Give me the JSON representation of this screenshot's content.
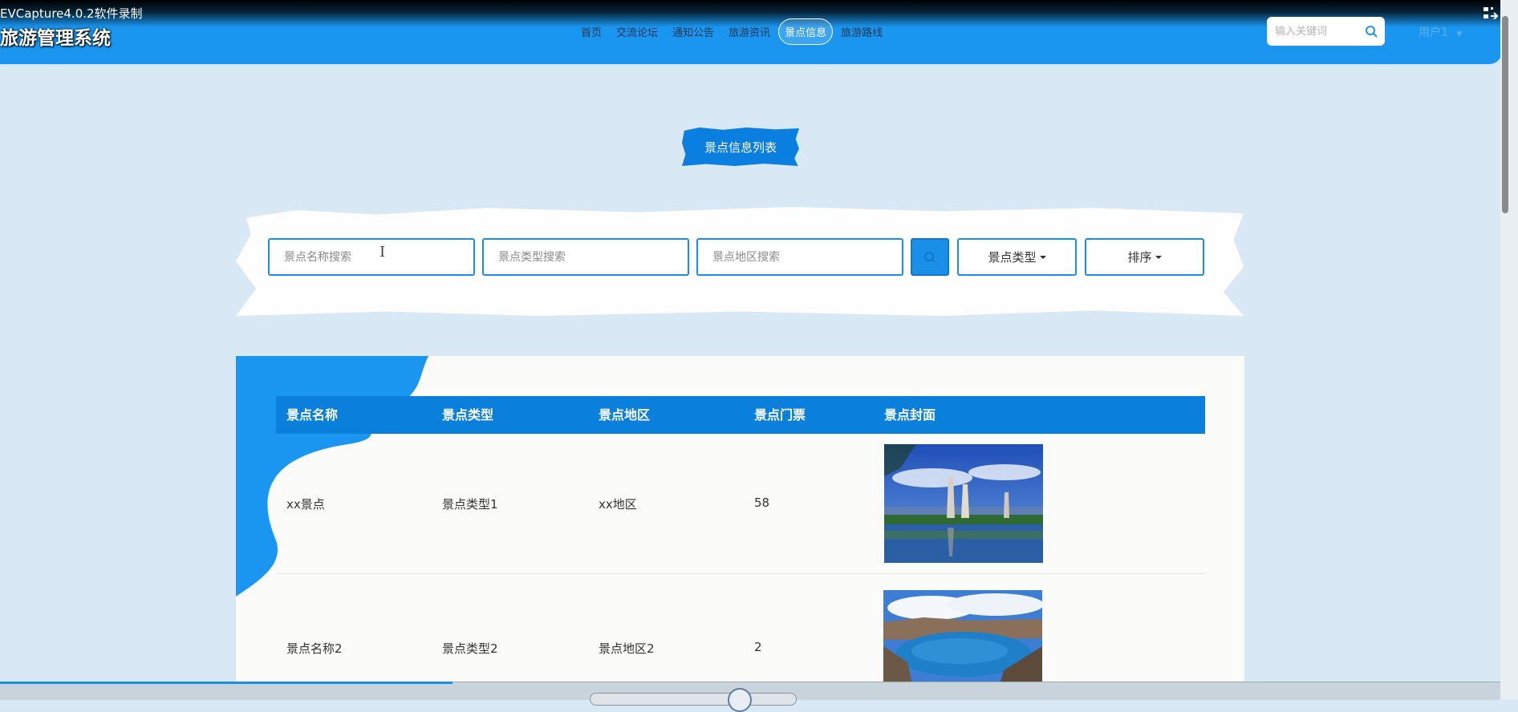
{
  "recorder": {
    "caption": "EVCapture4.0.2软件录制"
  },
  "header": {
    "site_title": "旅游管理系统",
    "nav": [
      {
        "label": "首页"
      },
      {
        "label": "交流论坛"
      },
      {
        "label": "通知公告"
      },
      {
        "label": "旅游资讯"
      },
      {
        "label": "景点信息",
        "active": true
      },
      {
        "label": "旅游路线"
      }
    ],
    "search_placeholder": "输入关键词",
    "user_label": "用户1"
  },
  "page": {
    "title": "景点信息列表",
    "filters": {
      "name_placeholder": "景点名称搜索",
      "type_placeholder": "景点类型搜索",
      "region_placeholder": "景点地区搜索",
      "type_dropdown": "景点类型",
      "sort_dropdown": "排序"
    },
    "table": {
      "columns": [
        "景点名称",
        "景点类型",
        "景点地区",
        "景点门票",
        "景点封面"
      ],
      "rows": [
        {
          "name": "xx景点",
          "type": "景点类型1",
          "region": "xx地区",
          "ticket": "58",
          "cover": "pagoda-lake-photo"
        },
        {
          "name": "景点名称2",
          "type": "景点类型2",
          "region": "景点地区2",
          "ticket": "2",
          "cover": "crater-lake-photo"
        }
      ]
    }
  },
  "colors": {
    "header": "#1a96f0",
    "accent": "#0b7fdc",
    "page_bg": "#d9e8f5"
  }
}
